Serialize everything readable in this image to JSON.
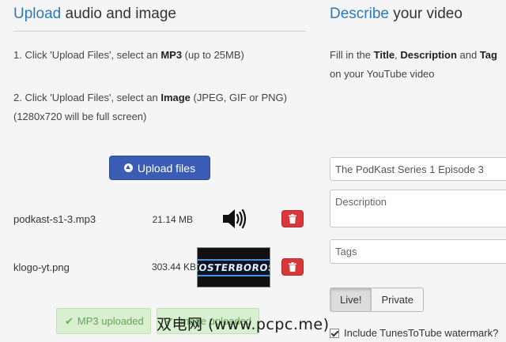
{
  "upload_section": {
    "heading_accent": "Upload",
    "heading_rest": " audio and image",
    "step1_prefix": "1. Click 'Upload Files', select an ",
    "step1_bold": "MP3",
    "step1_suffix": " (up to 25MB)",
    "step2_prefix": "2. Click 'Upload Files', select an ",
    "step2_bold": "Image",
    "step2_suffix": " (JPEG, GIF or PNG)",
    "step2_line2": "(1280x720 will be full screen)",
    "upload_button_label": "Upload files",
    "files": [
      {
        "name": "podkast-s1-3.mp3",
        "size": "21.14 MB",
        "preview_icon": "speaker-icon"
      },
      {
        "name": "klogo-yt.png",
        "size": "303.44 KB",
        "preview_icon": "image-thumbnail",
        "thumbnail_text": "KOSTERBOROS"
      }
    ],
    "mp3_status": "MP3 uploaded",
    "image_status": "Image uploaded"
  },
  "describe_section": {
    "heading_accent": "Describe",
    "heading_rest": " your video",
    "instr_prefix": "Fill in the ",
    "instr_title": "Title",
    "instr_comma": ", ",
    "instr_description": "Description",
    "instr_and": " and ",
    "instr_tags": "Tag",
    "instr_line2": "on your YouTube video",
    "title_value": "The PodKast Series 1 Episode 3",
    "description_placeholder": "Description",
    "tags_placeholder": "Tags",
    "privacy_live": "Live!",
    "privacy_private": "Private",
    "watermark_label": "Include TunesToTube watermark?"
  },
  "watermark": "双电网 (www.pcpc.me)",
  "colors": {
    "accent": "#2a7ab6",
    "upload_button": "#3a5cb4",
    "delete_button": "#d9383a",
    "success_bg": "#d8efd0",
    "success_text": "#69a35a"
  }
}
